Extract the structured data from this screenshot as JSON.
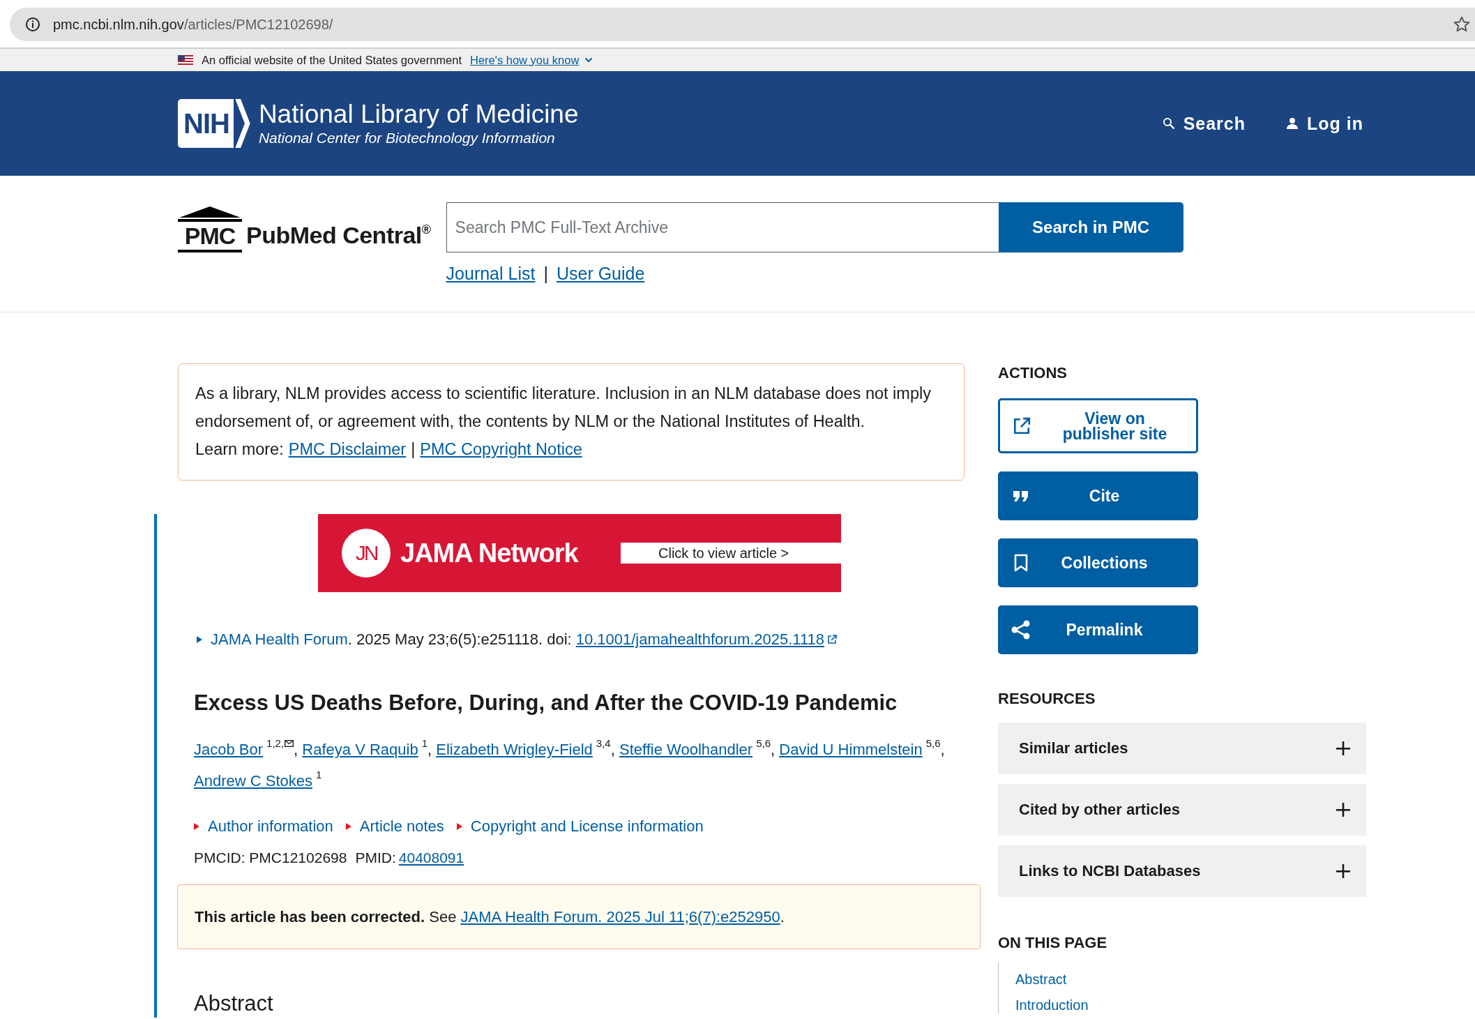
{
  "address_bar": {
    "host": "pmc.ncbi.nlm.nih.gov",
    "path": "/articles/PMC12102698/"
  },
  "gov_banner": {
    "text": "An official website of the United States government",
    "link": "Here's how you know"
  },
  "header": {
    "logo_text": "NIH",
    "title": "National Library of Medicine",
    "subtitle": "National Center for Biotechnology Information",
    "nav": [
      {
        "kind": "search",
        "label": "Search"
      },
      {
        "kind": "login",
        "label": "Log in"
      }
    ]
  },
  "pmc": {
    "logo_mark": "PMC",
    "logo_name": "PubMed Central",
    "logo_reg": "®",
    "search_placeholder": "Search PMC Full-Text Archive",
    "search_button": "Search in PMC",
    "links": [
      "Journal List",
      "User Guide"
    ],
    "link_separator": "|"
  },
  "disclaimer": {
    "text": "As a library, NLM provides access to scientific literature. Inclusion in an NLM database does not imply endorsement of, or agreement with, the contents by NLM or the National Institutes of Health.",
    "learn_more": "Learn more:",
    "links": [
      "PMC Disclaimer",
      "PMC Copyright Notice"
    ],
    "separator": "|"
  },
  "publisher_banner": {
    "mark": "JN",
    "brand": "JAMA Network",
    "cta": "Click to view article >"
  },
  "citation": {
    "journal": "JAMA Health Forum",
    "details": ". 2025 May 23;6(5):e251118. doi:",
    "doi": "10.1001/jamahealthforum.2025.1118"
  },
  "article": {
    "title": "Excess US Deaths Before, During, and After the COVID-19 Pandemic",
    "authors": [
      {
        "name": "Jacob Bor",
        "affiliations": "1,2,",
        "email": true,
        "separator": ","
      },
      {
        "name": "Rafeya V Raquib",
        "affiliations": "1",
        "email": false,
        "separator": ","
      },
      {
        "name": "Elizabeth Wrigley-Field",
        "affiliations": "3,4",
        "email": false,
        "separator": ","
      },
      {
        "name": "Steffie Woolhandler",
        "affiliations": "5,6",
        "email": false,
        "separator": ","
      },
      {
        "name": "David U Himmelstein",
        "affiliations": "5,6",
        "email": false,
        "separator": ","
      },
      {
        "name": "Andrew C Stokes",
        "affiliations": "1",
        "email": false
      }
    ],
    "detail_links": [
      "Author information",
      "Article notes",
      "Copyright and License information"
    ],
    "pmcid": "PMCID: PMC12102698",
    "pmid_label": "PMID:",
    "pmid": "40408091",
    "correction": {
      "lead": "**This article has been corrected.** See",
      "link": "JAMA Health Forum. 2025 Jul 11;6(7):e252950",
      "tail": "."
    },
    "section_heading": "Abstract"
  },
  "sidebar": {
    "actions_heading": "ACTIONS",
    "actions": [
      {
        "kind": "external",
        "label": "View on publisher site",
        "outlined": true
      },
      {
        "kind": "cite",
        "label": "Cite",
        "outlined": false
      },
      {
        "kind": "collections",
        "label": "Collections",
        "outlined": false
      },
      {
        "kind": "permalink",
        "label": "Permalink",
        "outlined": false
      }
    ],
    "resources_heading": "RESOURCES",
    "resources": [
      {
        "label": "Similar articles",
        "expanded": false
      },
      {
        "label": "Cited by other articles",
        "expanded": false
      },
      {
        "label": "Links to NCBI Databases",
        "expanded": false
      }
    ],
    "on_this_page_heading": "ON THIS PAGE",
    "on_this_page": [
      "Abstract",
      "Introduction"
    ]
  }
}
